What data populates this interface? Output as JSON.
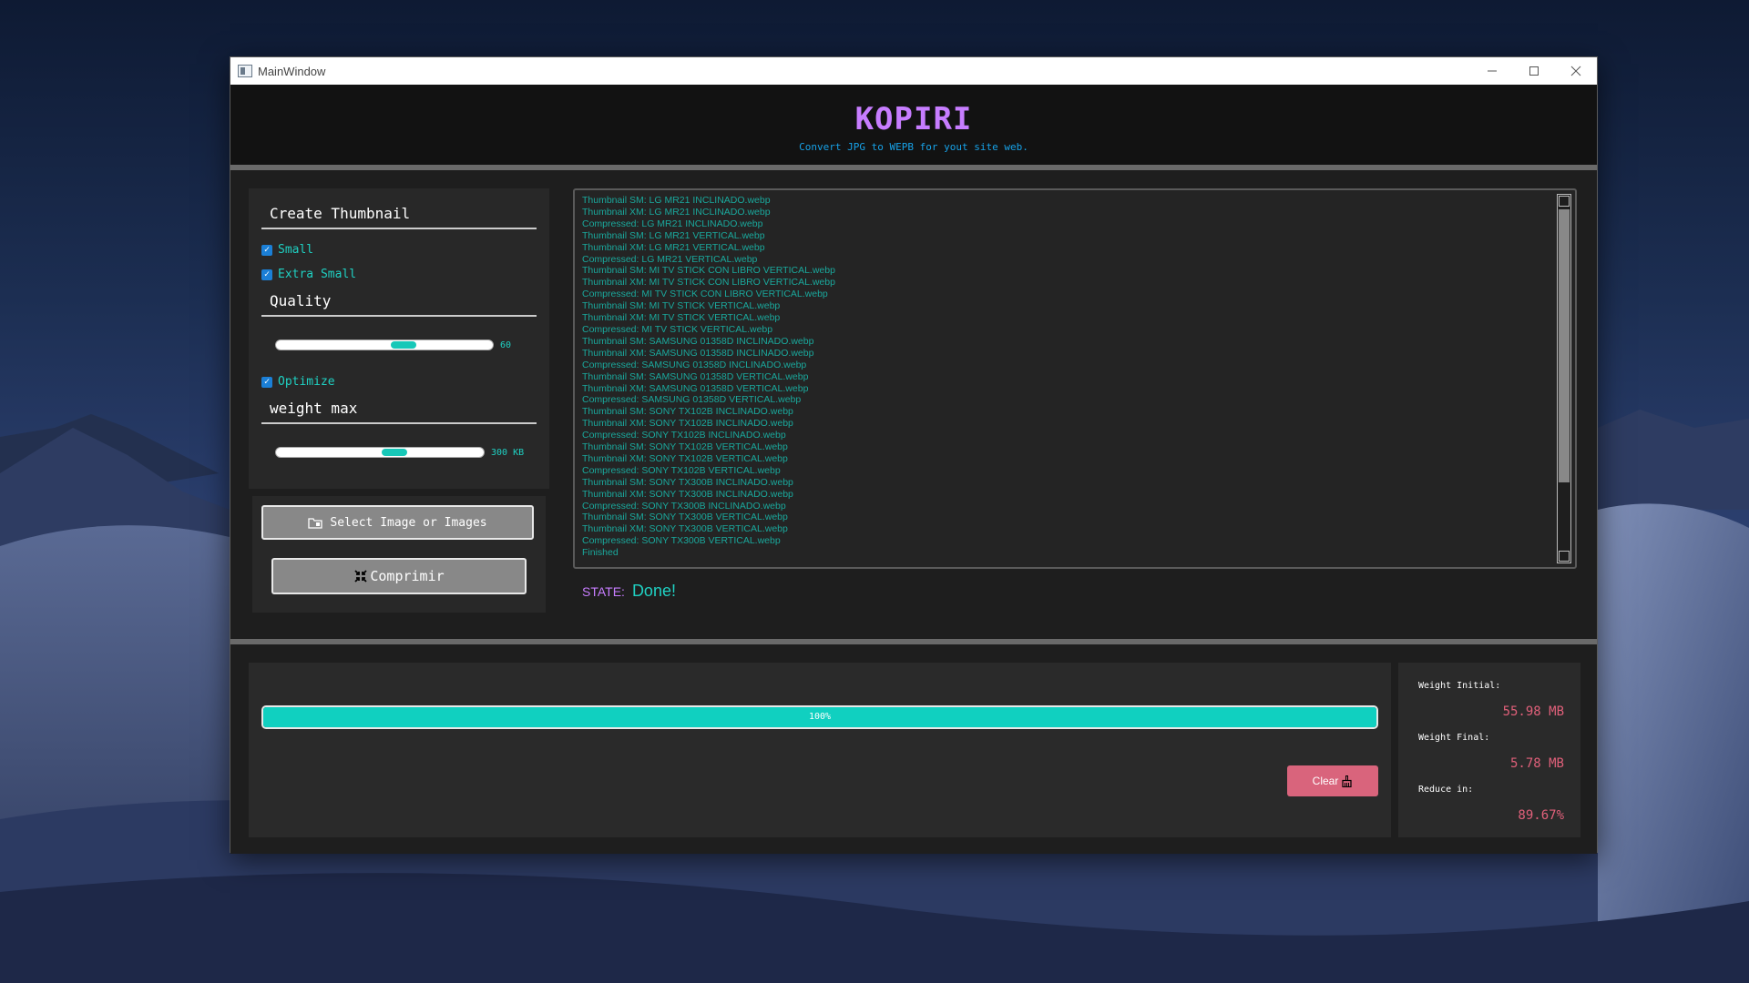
{
  "window": {
    "title": "MainWindow"
  },
  "header": {
    "app_name": "KOPIRI",
    "subtitle": "Convert JPG to WEPB for yout site web."
  },
  "options": {
    "thumbnail_title": "Create Thumbnail",
    "small_label": "Small",
    "small_checked": true,
    "extra_small_label": "Extra Small",
    "extra_small_checked": true,
    "quality_title": "Quality",
    "quality_value": "60",
    "optimize_label": "Optimize",
    "optimize_checked": true,
    "weight_title": "weight max",
    "weight_value": "300 KB"
  },
  "actions": {
    "select_label": "Select Image or Images",
    "compress_label": "Comprimir"
  },
  "log": [
    "Thumbnail SM: LG MR21 INCLINADO.webp",
    "Thumbnail XM: LG MR21 INCLINADO.webp",
    "Compressed: LG MR21 INCLINADO.webp",
    "Thumbnail SM: LG MR21 VERTICAL.webp",
    "Thumbnail XM: LG MR21 VERTICAL.webp",
    "Compressed: LG MR21 VERTICAL.webp",
    "Thumbnail SM: MI TV STICK CON LIBRO VERTICAL.webp",
    "Thumbnail XM: MI TV STICK CON LIBRO VERTICAL.webp",
    "Compressed: MI TV STICK CON LIBRO VERTICAL.webp",
    "Thumbnail SM: MI TV STICK VERTICAL.webp",
    "Thumbnail XM: MI TV STICK VERTICAL.webp",
    "Compressed: MI TV STICK VERTICAL.webp",
    "Thumbnail SM: SAMSUNG 01358D INCLINADO.webp",
    "Thumbnail XM: SAMSUNG 01358D INCLINADO.webp",
    "Compressed: SAMSUNG 01358D INCLINADO.webp",
    "Thumbnail SM: SAMSUNG 01358D VERTICAL.webp",
    "Thumbnail XM: SAMSUNG 01358D VERTICAL.webp",
    "Compressed: SAMSUNG 01358D VERTICAL.webp",
    "Thumbnail SM: SONY TX102B INCLINADO.webp",
    "Thumbnail XM: SONY TX102B INCLINADO.webp",
    "Compressed: SONY TX102B INCLINADO.webp",
    "Thumbnail SM: SONY TX102B VERTICAL.webp",
    "Thumbnail XM: SONY TX102B VERTICAL.webp",
    "Compressed: SONY TX102B VERTICAL.webp",
    "Thumbnail SM: SONY TX300B INCLINADO.webp",
    "Thumbnail XM: SONY TX300B INCLINADO.webp",
    "Compressed: SONY TX300B INCLINADO.webp",
    "Thumbnail SM: SONY TX300B VERTICAL.webp",
    "Thumbnail XM: SONY TX300B VERTICAL.webp",
    "Compressed: SONY TX300B VERTICAL.webp",
    "Finished"
  ],
  "state": {
    "label": "STATE:",
    "value": "Done!"
  },
  "progress": {
    "percent": 100,
    "text": "100%"
  },
  "clear_label": "Clear",
  "stats": {
    "initial_label": "Weight Initial:",
    "initial_value": "55.98 MB",
    "final_label": "Weight Final:",
    "final_value": "5.78 MB",
    "reduce_label": "Reduce in:",
    "reduce_value": "89.67%"
  },
  "colors": {
    "accent_purple": "#c77dff",
    "accent_teal": "#1fd0c2",
    "accent_red": "#e0607a",
    "progress": "#10d0c0"
  },
  "icons": [
    "app-window-icon",
    "minimize-icon",
    "maximize-icon",
    "close-icon",
    "folder-icon",
    "compress-icon",
    "broom-icon"
  ]
}
